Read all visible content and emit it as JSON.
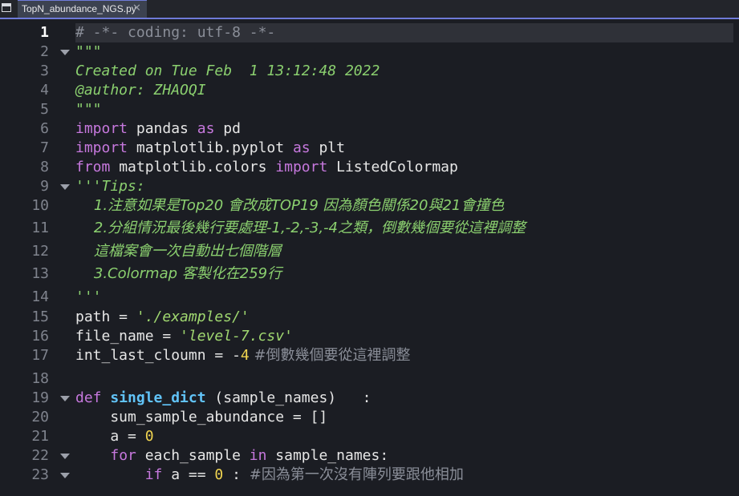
{
  "tab": {
    "filename": "TopN_abundance_NGS.py",
    "close_glyph": "✕"
  },
  "editor": {
    "current_line": 1,
    "lines": [
      {
        "n": "1",
        "tokens": [
          {
            "t": "# -*- coding: utf-8 -*-",
            "c": "cmt"
          }
        ]
      },
      {
        "n": "2",
        "fold": true,
        "tokens": [
          {
            "t": "\"\"\"",
            "c": "doc"
          }
        ]
      },
      {
        "n": "3",
        "tokens": [
          {
            "t": "Created on Tue Feb  1 13:12:48 2022",
            "c": "doc"
          }
        ]
      },
      {
        "n": "4",
        "tokens": [
          {
            "t": "@author: ZHAOQI",
            "c": "doc"
          }
        ]
      },
      {
        "n": "5",
        "tokens": [
          {
            "t": "\"\"\"",
            "c": "doc"
          }
        ]
      },
      {
        "n": "6",
        "tokens": [
          {
            "t": "import",
            "c": "kw"
          },
          {
            "t": " pandas ",
            "c": ""
          },
          {
            "t": "as",
            "c": "kw"
          },
          {
            "t": " pd",
            "c": ""
          }
        ]
      },
      {
        "n": "7",
        "tokens": [
          {
            "t": "import",
            "c": "kw"
          },
          {
            "t": " matplotlib.pyplot ",
            "c": ""
          },
          {
            "t": "as",
            "c": "kw"
          },
          {
            "t": " plt",
            "c": ""
          }
        ]
      },
      {
        "n": "8",
        "tokens": [
          {
            "t": "from",
            "c": "kw"
          },
          {
            "t": " matplotlib.colors ",
            "c": ""
          },
          {
            "t": "import",
            "c": "kw"
          },
          {
            "t": " ListedColormap",
            "c": ""
          }
        ]
      },
      {
        "n": "9",
        "fold": true,
        "tokens": [
          {
            "t": "'''Tips:",
            "c": "doc"
          }
        ]
      },
      {
        "n": "10",
        "tokens": [
          {
            "t": "    1.注意如果是Top20 會改成TOP19 因為顏色關係20與21會撞色",
            "c": "doc"
          }
        ]
      },
      {
        "n": "11",
        "tokens": [
          {
            "t": "    2.分組情況最後幾行要處理-1,-2,-3,-4之類，倒數幾個要從這裡調整",
            "c": "doc"
          }
        ]
      },
      {
        "n": "12",
        "tokens": [
          {
            "t": "    這檔案會一次自動出七個階層",
            "c": "doc"
          }
        ]
      },
      {
        "n": "13",
        "tokens": [
          {
            "t": "    3.Colormap 客製化在259行",
            "c": "doc"
          }
        ]
      },
      {
        "n": "14",
        "tokens": [
          {
            "t": "'''",
            "c": "doc"
          }
        ]
      },
      {
        "n": "15",
        "tokens": [
          {
            "t": "path = ",
            "c": ""
          },
          {
            "t": "'./examples/'",
            "c": "str"
          }
        ]
      },
      {
        "n": "16",
        "tokens": [
          {
            "t": "file_name = ",
            "c": ""
          },
          {
            "t": "'level-7.csv'",
            "c": "str"
          }
        ]
      },
      {
        "n": "17",
        "tokens": [
          {
            "t": "int_last_cloumn = -",
            "c": ""
          },
          {
            "t": "4",
            "c": "num"
          },
          {
            "t": " #倒數幾個要從這裡調整",
            "c": "cmt"
          }
        ]
      },
      {
        "n": "18",
        "tokens": []
      },
      {
        "n": "19",
        "fold": true,
        "tokens": [
          {
            "t": "def",
            "c": "kw"
          },
          {
            "t": " ",
            "c": ""
          },
          {
            "t": "single_dict",
            "c": "fn"
          },
          {
            "t": " (sample_names)   :",
            "c": ""
          }
        ]
      },
      {
        "n": "20",
        "tokens": [
          {
            "t": "    sum_sample_abundance = []",
            "c": ""
          }
        ]
      },
      {
        "n": "21",
        "tokens": [
          {
            "t": "    a = ",
            "c": ""
          },
          {
            "t": "0",
            "c": "num"
          }
        ]
      },
      {
        "n": "22",
        "fold": true,
        "tokens": [
          {
            "t": "    ",
            "c": ""
          },
          {
            "t": "for",
            "c": "kw"
          },
          {
            "t": " each_sample ",
            "c": ""
          },
          {
            "t": "in",
            "c": "kw"
          },
          {
            "t": " sample_names:",
            "c": ""
          }
        ]
      },
      {
        "n": "23",
        "fold": true,
        "tokens": [
          {
            "t": "        ",
            "c": ""
          },
          {
            "t": "if",
            "c": "kw"
          },
          {
            "t": " a == ",
            "c": ""
          },
          {
            "t": "0",
            "c": "num"
          },
          {
            "t": " : ",
            "c": ""
          },
          {
            "t": "#因為第一次沒有陣列要跟他相加",
            "c": "cmt"
          }
        ]
      }
    ]
  }
}
